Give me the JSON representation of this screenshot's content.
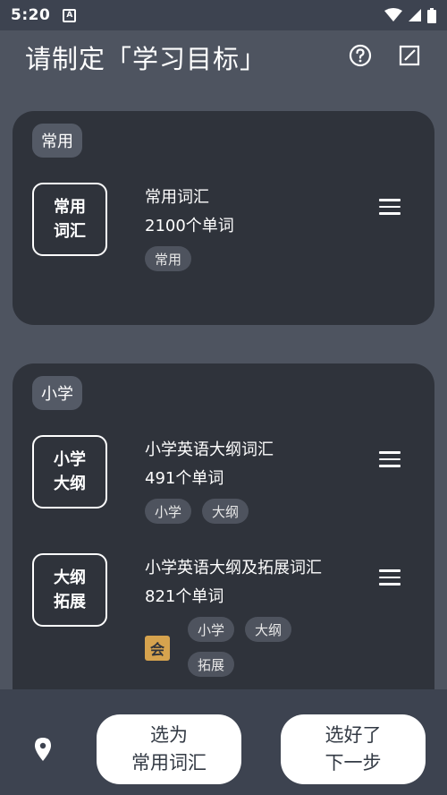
{
  "statusbar": {
    "time": "5:20",
    "app_icon_letter": "A"
  },
  "header": {
    "title": "请制定「学习目标」",
    "icons": [
      "help-icon",
      "edit-icon"
    ]
  },
  "groups": [
    {
      "label": "常用",
      "vocabs": [
        {
          "cover_line1": "常用",
          "cover_line2": "词汇",
          "name": "常用词汇",
          "count": "2100个单词",
          "tags": [
            "常用"
          ]
        }
      ]
    },
    {
      "label": "小学",
      "vocabs": [
        {
          "cover_line1": "小学",
          "cover_line2": "大纲",
          "name": "小学英语大纲词汇",
          "count": "491个单词",
          "tags": [
            "小学",
            "大纲"
          ]
        },
        {
          "cover_line1": "大纲",
          "cover_line2": "拓展",
          "name": "小学英语大纲及拓展词汇",
          "count": "821个单词",
          "badge": "会",
          "tags": [
            "小学",
            "大纲",
            "拓展"
          ]
        }
      ]
    }
  ],
  "bottom": {
    "btn_common_line1": "选为",
    "btn_common_line2": "常用词汇",
    "btn_next_line1": "选好了",
    "btn_next_line2": "下一步",
    "location_icon": "location-pin-icon"
  },
  "colors": {
    "background": "#4e5460",
    "card": "#2f333b",
    "bars": "#3d4350",
    "badge": "#d6a34e"
  }
}
